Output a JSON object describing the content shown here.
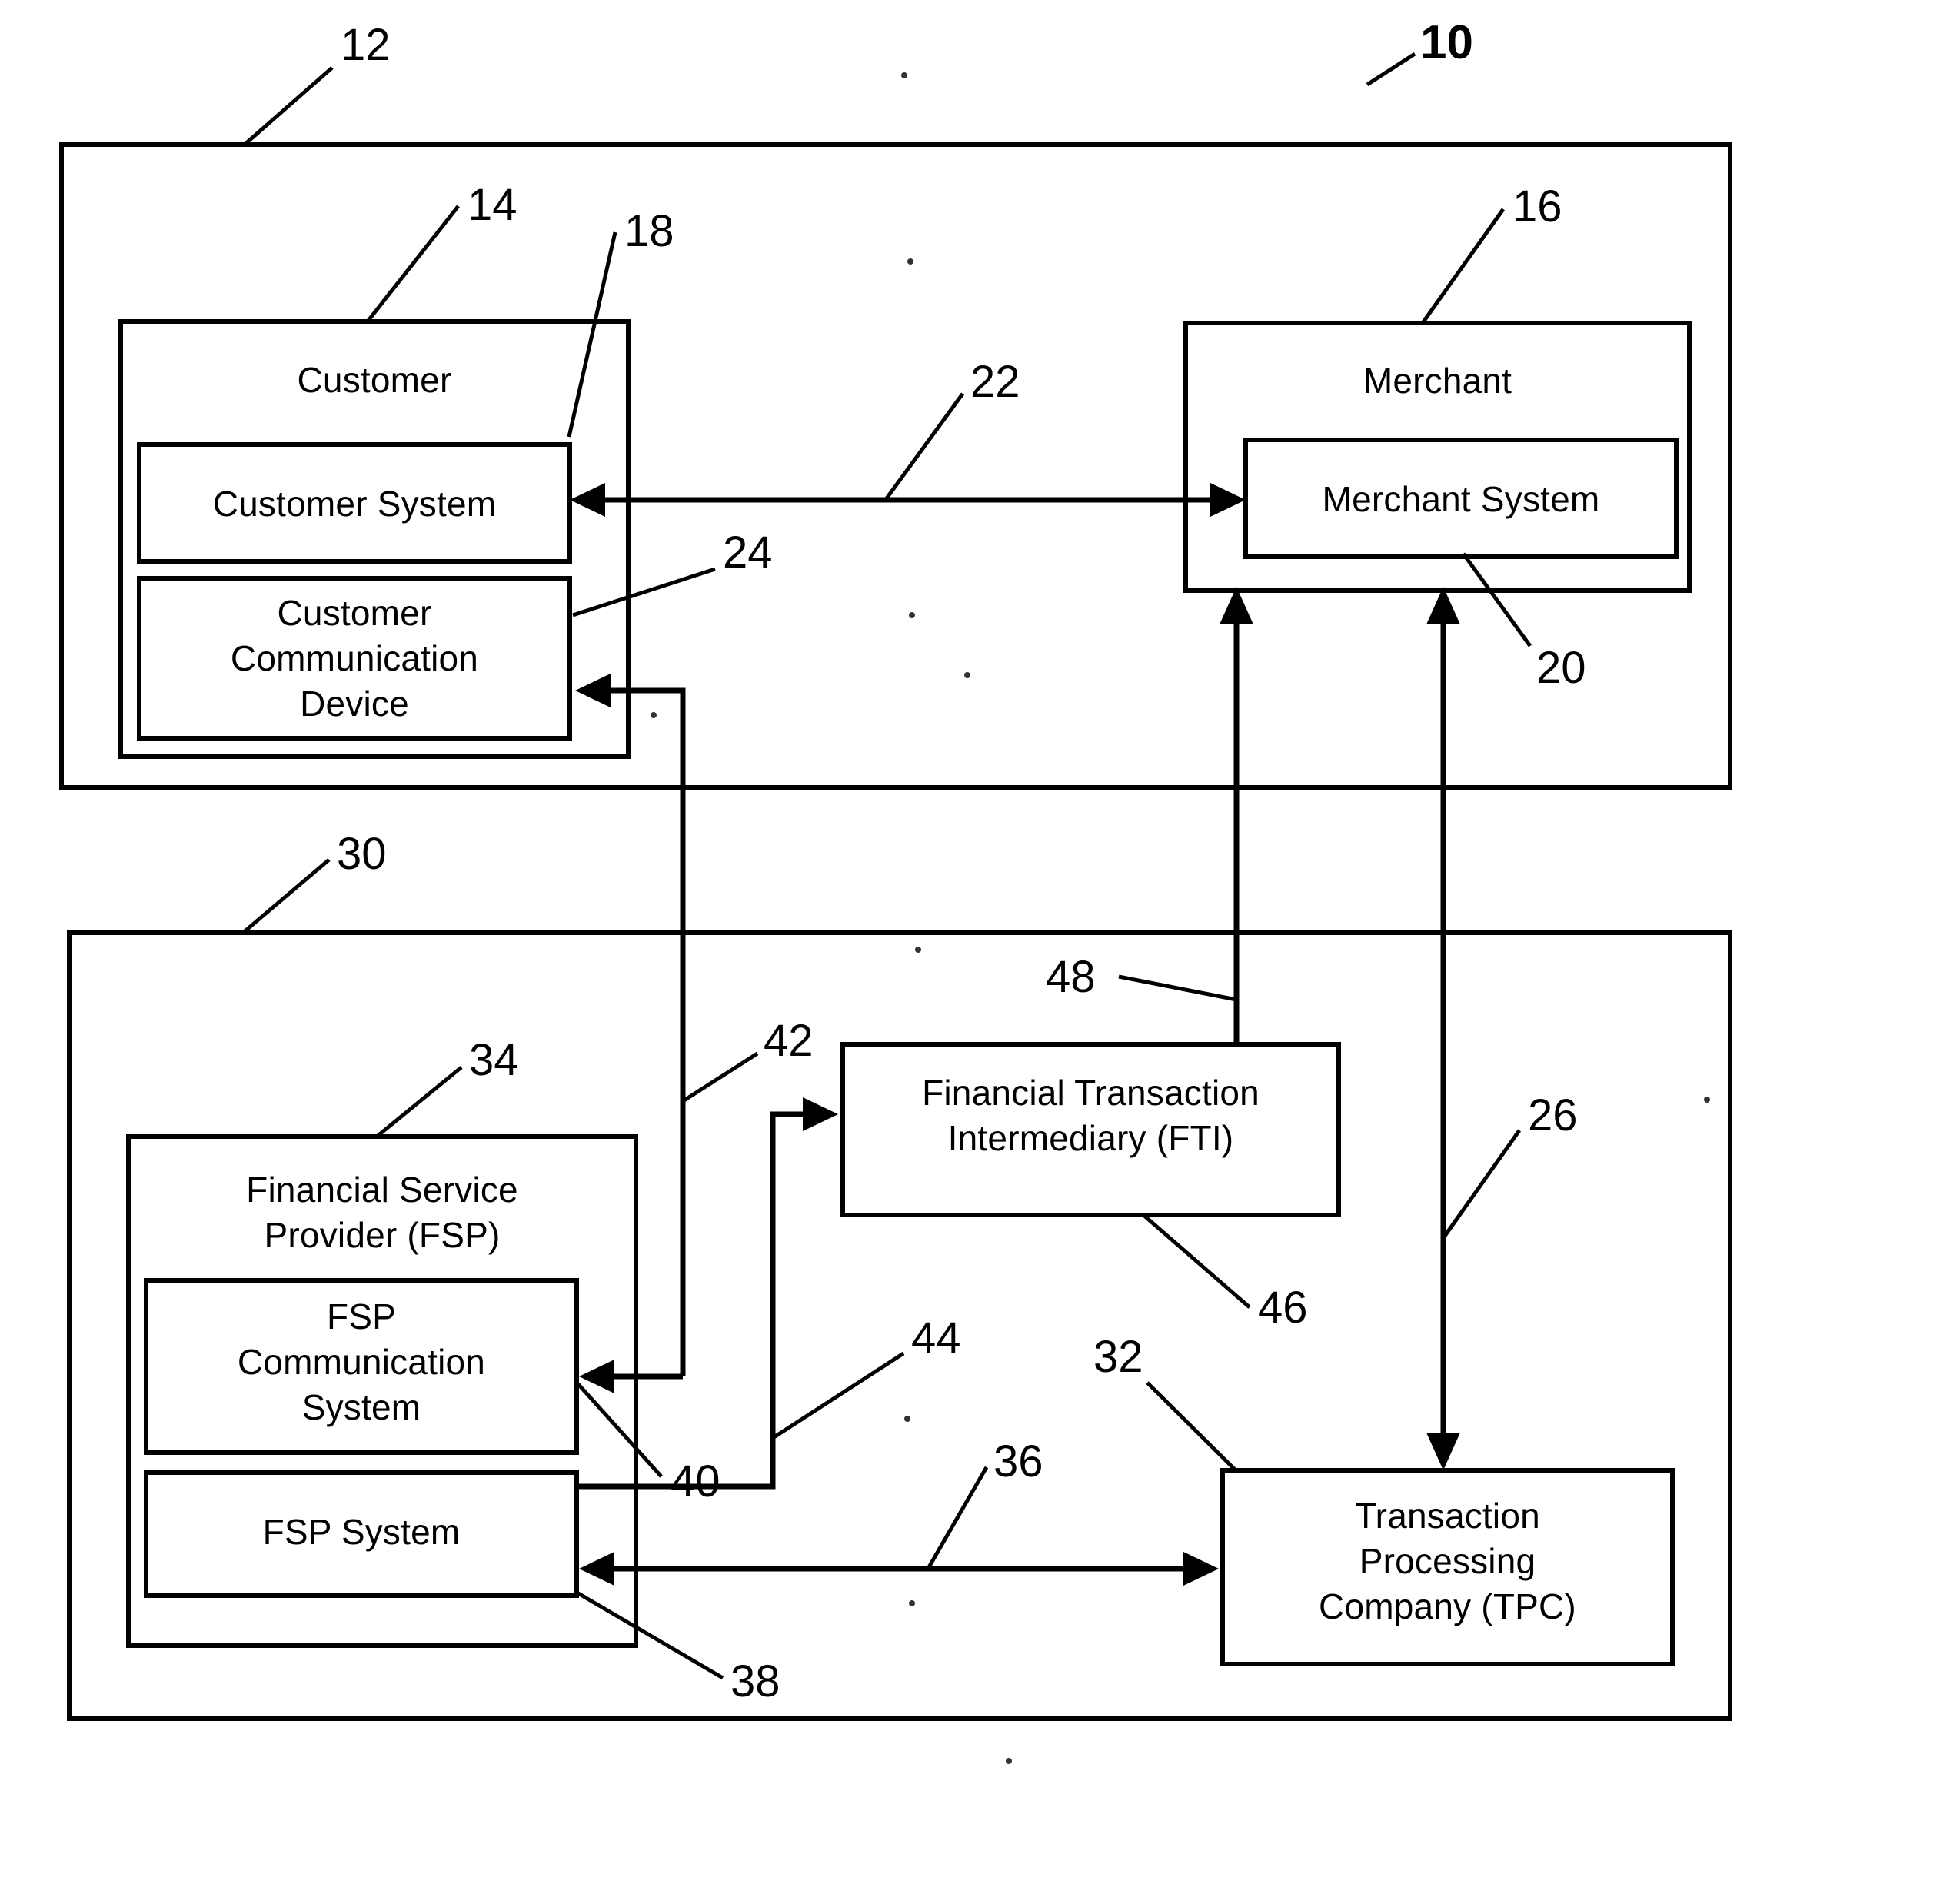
{
  "figure": {
    "type": "patent-block-diagram",
    "title": "Financial transaction system block diagram",
    "line_color": "#000000",
    "background_color": "#ffffff"
  },
  "nodes": {
    "system_outer": {
      "label": "",
      "ref": "10"
    },
    "customer_group": {
      "label": "",
      "ref": "12"
    },
    "customer": {
      "label": "Customer",
      "ref": "14"
    },
    "customer_system": {
      "label": "Customer System",
      "ref": "18"
    },
    "customer_communication_device": {
      "label": "Customer\nCommunication\nDevice",
      "ref": "24"
    },
    "merchant": {
      "label": "Merchant",
      "ref": "16"
    },
    "merchant_system": {
      "label": "Merchant System",
      "ref": "20"
    },
    "financial_group": {
      "label": "",
      "ref": "30"
    },
    "fsp": {
      "label": "Financial Service\nProvider (FSP)",
      "ref": "34"
    },
    "fsp_communication_system": {
      "label": "FSP\nCommunication\nSystem",
      "ref": "40"
    },
    "fsp_system": {
      "label": "FSP System",
      "ref": "38"
    },
    "fti": {
      "label": "Financial Transaction\nIntermediary (FTI)",
      "ref": "46"
    },
    "tpc": {
      "label": "Transaction\nProcessing\nCompany (TPC)",
      "ref": "32"
    }
  },
  "connections": {
    "customer_system_to_merchant_system": {
      "ref": "22",
      "arrows": "both"
    },
    "merchant_system_to_tpc": {
      "ref": "26",
      "arrows": "both"
    },
    "fti_to_merchant_system": {
      "ref": "48",
      "arrows": "up"
    },
    "fsp_system_to_tpc": {
      "ref": "36",
      "arrows": "both"
    },
    "fsp_system_to_fti": {
      "ref": "44",
      "arrows": "right"
    },
    "ccd_to_fsp_communication_system": {
      "ref": "42",
      "arrows": "left"
    }
  },
  "reference_numerals": [
    {
      "id": "10",
      "text": "10",
      "bold": true
    },
    {
      "id": "12",
      "text": "12",
      "bold": false
    },
    {
      "id": "14",
      "text": "14",
      "bold": false
    },
    {
      "id": "16",
      "text": "16",
      "bold": false
    },
    {
      "id": "18",
      "text": "18",
      "bold": false
    },
    {
      "id": "20",
      "text": "20",
      "bold": false
    },
    {
      "id": "22",
      "text": "22",
      "bold": false
    },
    {
      "id": "24",
      "text": "24",
      "bold": false
    },
    {
      "id": "26",
      "text": "26",
      "bold": false
    },
    {
      "id": "30",
      "text": "30",
      "bold": false
    },
    {
      "id": "32",
      "text": "32",
      "bold": false
    },
    {
      "id": "34",
      "text": "34",
      "bold": false
    },
    {
      "id": "36",
      "text": "36",
      "bold": false
    },
    {
      "id": "38",
      "text": "38",
      "bold": false
    },
    {
      "id": "40",
      "text": "40",
      "bold": false
    },
    {
      "id": "42",
      "text": "42",
      "bold": false
    },
    {
      "id": "44",
      "text": "44",
      "bold": false
    },
    {
      "id": "46",
      "text": "46",
      "bold": false
    },
    {
      "id": "48",
      "text": "48",
      "bold": false
    }
  ]
}
